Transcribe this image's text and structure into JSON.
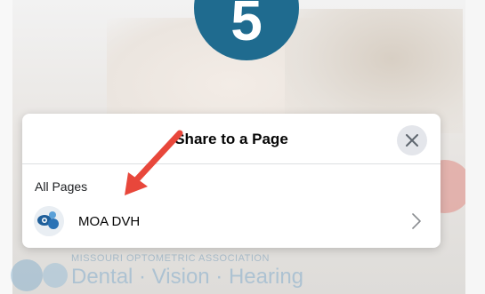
{
  "step": {
    "number": "5"
  },
  "dialog": {
    "title": "Share to a Page",
    "section_label": "All Pages",
    "pages": [
      {
        "name": "MOA DVH"
      }
    ],
    "close_icon": "close-icon",
    "chevron_icon": "chevron-right-icon"
  },
  "background": {
    "org_name": "MISSOURI OPTOMETRIC ASSOCIATION",
    "brand": "Dental · Vision · Hearing"
  },
  "colors": {
    "badge": "#1f6b8f",
    "arrow": "#e8473b",
    "close_bg": "#e4e6eb"
  }
}
